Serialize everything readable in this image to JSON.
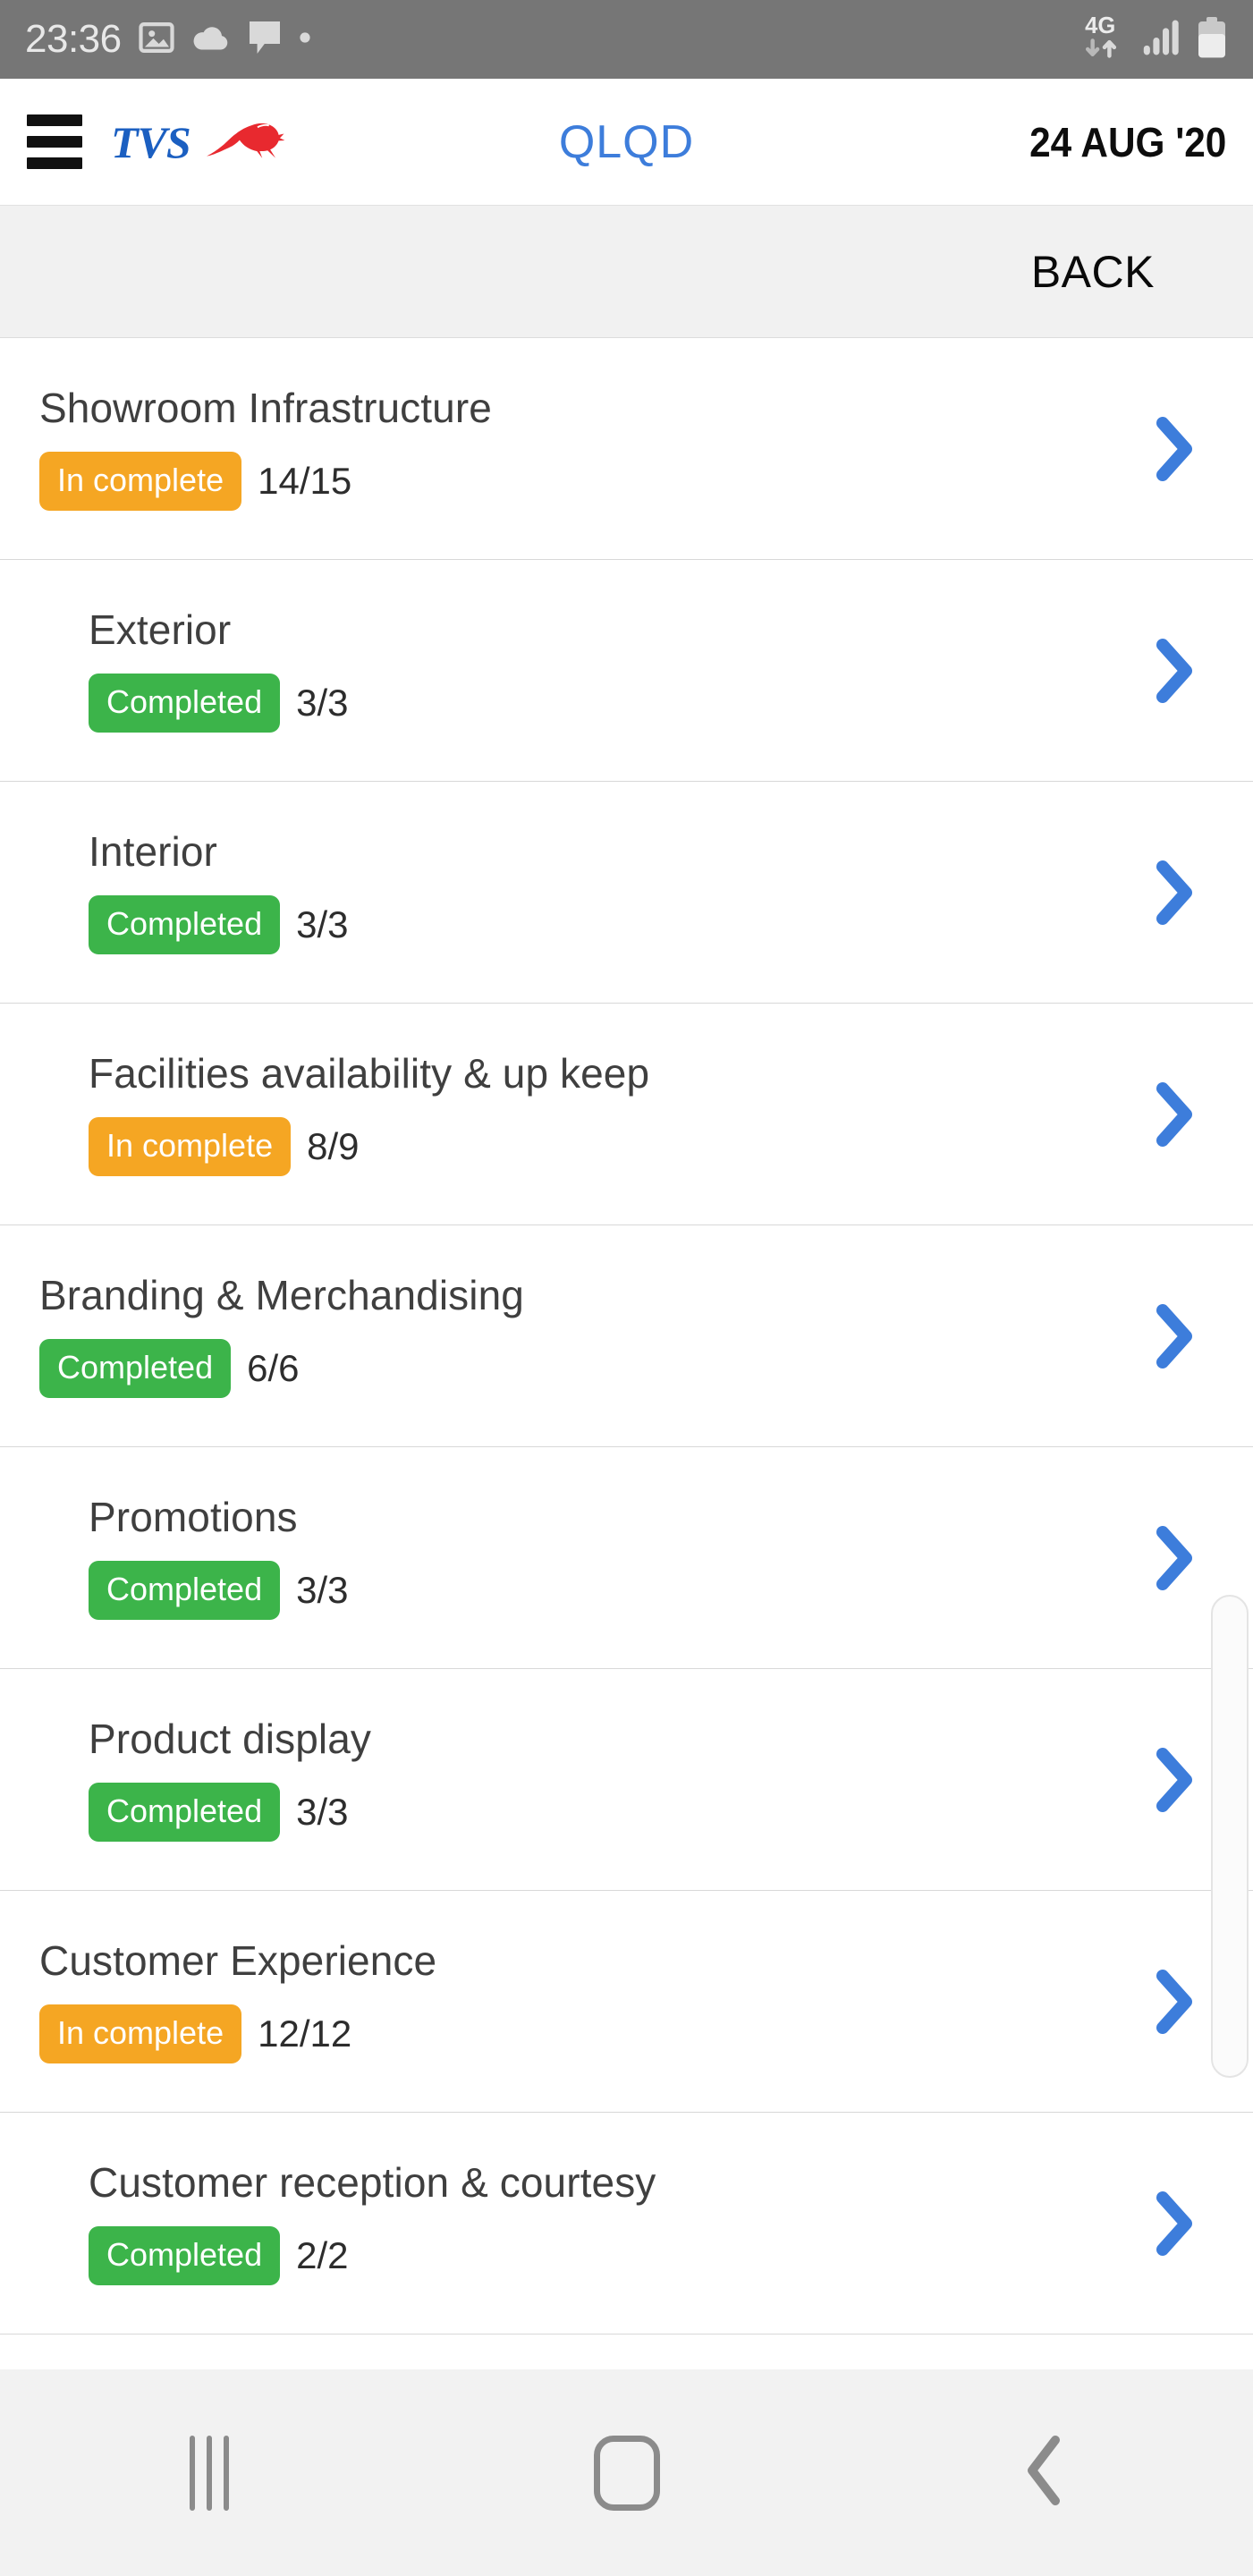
{
  "status_bar": {
    "time": "23:36",
    "left_icons": [
      "image-icon",
      "cloud-icon",
      "message-icon",
      "dot-icon"
    ],
    "network_label": "4G",
    "right_icons": [
      "data-transfer-icon",
      "signal-icon",
      "battery-icon"
    ],
    "background_color": "#767676"
  },
  "app_bar": {
    "menu_icon": "hamburger-menu-icon",
    "brand_name": "TVS",
    "brand_logo_icon": "tvs-horse-logo-icon",
    "title": "QLQD",
    "title_color": "#3d7ddb",
    "date": "24 AUG '20"
  },
  "back_bar": {
    "label": "BACK"
  },
  "checklist": {
    "chevron_icon": "chevron-right-icon",
    "chevron_color": "#3d7ddb",
    "status_colors": {
      "incomplete": "#f5a623",
      "completed": "#3cb44a"
    },
    "items": [
      {
        "title": "Showroom Infrastructure",
        "status": "In complete",
        "state": "incomplete",
        "count": "14/15",
        "level": 1
      },
      {
        "title": "Exterior",
        "status": "Completed",
        "state": "completed",
        "count": "3/3",
        "level": 2
      },
      {
        "title": "Interior",
        "status": "Completed",
        "state": "completed",
        "count": "3/3",
        "level": 2
      },
      {
        "title": "Facilities availability & up keep",
        "status": "In complete",
        "state": "incomplete",
        "count": "8/9",
        "level": 2
      },
      {
        "title": "Branding & Merchandising",
        "status": "Completed",
        "state": "completed",
        "count": "6/6",
        "level": 1
      },
      {
        "title": "Promotions",
        "status": "Completed",
        "state": "completed",
        "count": "3/3",
        "level": 2
      },
      {
        "title": "Product display",
        "status": "Completed",
        "state": "completed",
        "count": "3/3",
        "level": 2
      },
      {
        "title": "Customer Experience",
        "status": "In complete",
        "state": "incomplete",
        "count": "12/12",
        "level": 1
      },
      {
        "title": "Customer reception & courtesy",
        "status": "Completed",
        "state": "completed",
        "count": "2/2",
        "level": 2
      }
    ]
  },
  "nav_bar": {
    "buttons": [
      "recents-icon",
      "home-icon",
      "back-icon"
    ]
  }
}
